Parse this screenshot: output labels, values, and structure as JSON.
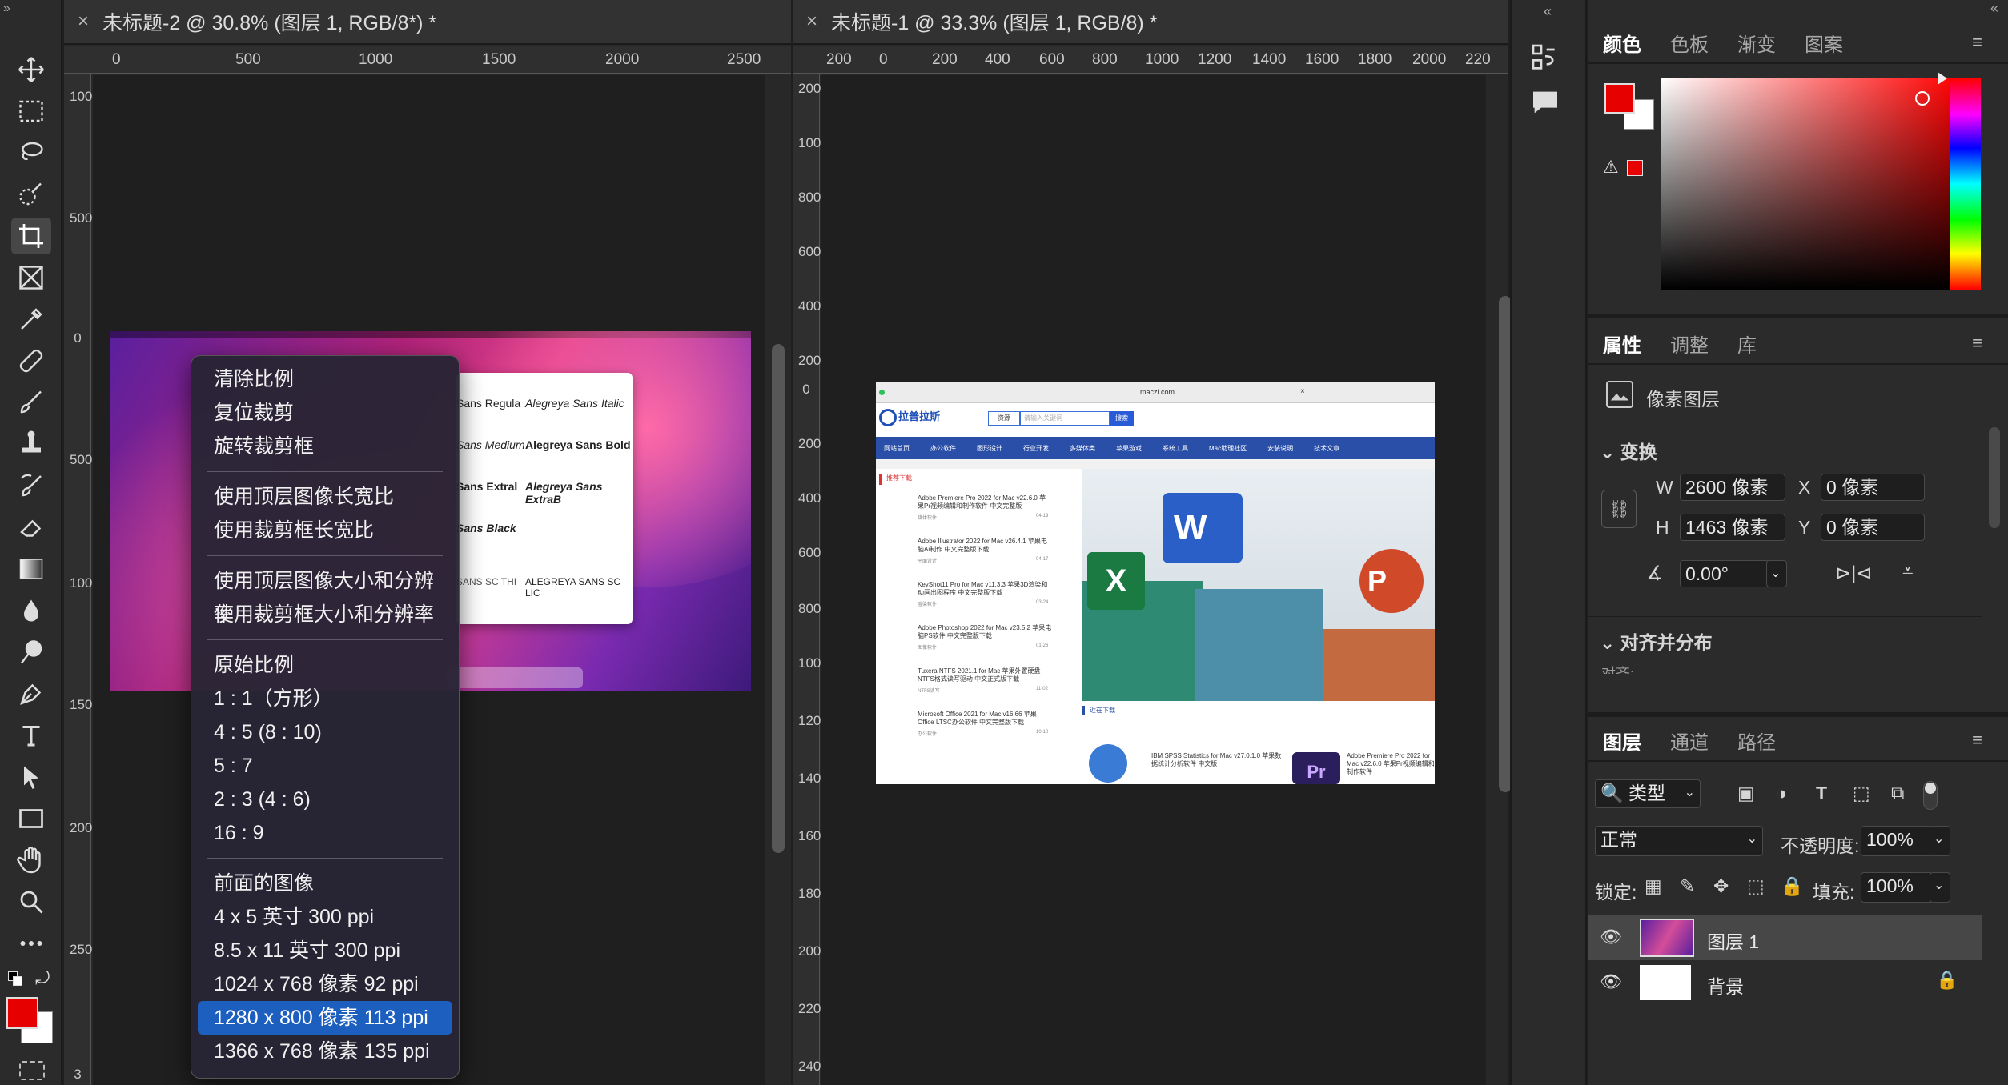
{
  "toolbar": {
    "tools": [
      "move-tool",
      "marquee-tool",
      "lasso-tool",
      "quick-select-tool",
      "crop-tool",
      "frame-tool",
      "eyedropper-tool",
      "healing-brush-tool",
      "brush-tool",
      "stamp-tool",
      "history-brush-tool",
      "eraser-tool",
      "gradient-tool",
      "blur-tool",
      "dodge-tool",
      "pen-tool",
      "type-tool",
      "path-select-tool",
      "rectangle-tool",
      "hand-tool",
      "zoom-tool",
      "more-tools"
    ],
    "foreground_color": "#e60000",
    "background_color": "#ffffff"
  },
  "doc1": {
    "tab_title": "未标题-2 @ 30.8% (图层 1, RGB/8*) *",
    "ruler_h": [
      "0",
      "500",
      "1000",
      "1500",
      "2000",
      "2500"
    ],
    "ruler_v": [
      "1000",
      "500",
      "0",
      "500",
      "1000",
      "1500",
      "2000",
      "2500",
      "3"
    ]
  },
  "doc2": {
    "tab_title": "未标题-1 @ 33.3% (图层 1, RGB/8) *",
    "ruler_h": [
      "200",
      "0",
      "200",
      "400",
      "600",
      "800",
      "1000",
      "1200",
      "1400",
      "1600",
      "1800",
      "2000",
      "220"
    ],
    "ruler_v": [
      "200",
      "100",
      "800",
      "600",
      "400",
      "200",
      "0",
      "200",
      "400",
      "600",
      "800",
      "1000",
      "1200",
      "1400",
      "1600",
      "1800",
      "2000",
      "2200",
      "2400"
    ]
  },
  "context_menu": {
    "groups": [
      [
        "清除比例",
        "复位裁剪",
        "旋转裁剪框"
      ],
      [
        "使用顶层图像长宽比",
        "使用裁剪框长宽比"
      ],
      [
        "使用顶层图像大小和分辨率",
        "使用裁剪框大小和分辨率"
      ],
      [
        "原始比例",
        "1 : 1（方形）",
        "4 : 5 (8 : 10)",
        "5 : 7",
        "2 : 3 (4 : 6)",
        "16 : 9"
      ],
      [
        "前面的图像",
        "4 x 5 英寸 300 ppi",
        "8.5 x 11 英寸 300 ppi",
        "1024 x 768 像素 92 ppi",
        "1280 x 800 像素 113 ppi",
        "1366 x 768 像素 135 ppi"
      ]
    ],
    "selected": "1280 x 800 像素 113 ppi"
  },
  "font_preview": [
    "Sans Regula",
    "Alegreya Sans Italic",
    "Sans Medium",
    "Alegreya Sans Bold",
    "Sans Extral",
    "Alegreya Sans ExtraB",
    "Sans Black",
    "SANS SC THI",
    "ALEGREYA SANS SC LIC"
  ],
  "website": {
    "url": "maczl.com",
    "logo": "拉普拉斯",
    "search_button": "搜索",
    "search_scope": "资源",
    "search_placeholder": "请输入关键词",
    "nav": [
      "网站首页",
      "办公软件",
      "图形设计",
      "行业开发",
      "多媒体类",
      "苹果游戏",
      "系统工具",
      "Mac助理社区",
      "安装说明",
      "技术文章"
    ],
    "section_recommend": "推荐下载",
    "section_recent": "近在下载",
    "articles": [
      {
        "title": "Adobe Premiere Pro 2022 for Mac v22.6.0 苹果Pr视频编辑和制作软件 中文完整版",
        "tag": "媒体软件",
        "date": "04-19"
      },
      {
        "title": "Adobe Illustrator 2022 for Mac v26.4.1 苹果电脑Ai制作 中文完整版下载",
        "tag": "平面设计",
        "date": "04-17"
      },
      {
        "title": "KeyShot11 Pro for Mac v11.3.3 苹果3D渲染和动画出图程序 中文完整版下载",
        "tag": "渲染软件",
        "date": "03-24"
      },
      {
        "title": "Adobe Photoshop 2022 for Mac v23.5.2 苹果电脑PS软件 中文完整版下载",
        "tag": "图像软件",
        "date": "01-26"
      },
      {
        "title": "Tuxera NTFS 2021.1 for Mac 苹果外置硬盘NTFS格式读写驱动 中文正式版下载",
        "tag": "NTFS读写",
        "date": "11-02"
      },
      {
        "title": "Microsoft Office 2021 for Mac v16.66 苹果Office LTSC办公软件 中文完整版下载",
        "tag": "办公软件",
        "date": "10-10"
      }
    ],
    "recent": [
      {
        "title": "IBM SPSS Statistics for Mac v27.0.1.0 苹果数据统计分析软件 中文版"
      },
      {
        "title": "Adobe Premiere Pro 2022 for Mac v22.6.0 苹果Pr视频编辑和制作软件"
      }
    ]
  },
  "color_panel": {
    "tabs": [
      "颜色",
      "色板",
      "渐变",
      "图案"
    ],
    "foreground": "#e60000",
    "background": "#ffffff"
  },
  "properties_panel": {
    "tabs": [
      "属性",
      "调整",
      "库"
    ],
    "layer_type": "像素图层",
    "transform_label": "变换",
    "w_label": "W",
    "w_value": "2600 像素",
    "h_label": "H",
    "h_value": "1463 像素",
    "x_label": "X",
    "x_value": "0 像素",
    "y_label": "Y",
    "y_value": "0 像素",
    "angle_value": "0.00°",
    "align_label": "对齐并分布",
    "align_sub": "对齐:"
  },
  "layers_panel": {
    "tabs": [
      "图层",
      "通道",
      "路径"
    ],
    "filter_label": "类型",
    "blend_mode": "正常",
    "opacity_label": "不透明度:",
    "opacity_value": "100%",
    "lock_label": "锁定:",
    "fill_label": "填充:",
    "fill_value": "100%",
    "layers": [
      {
        "name": "图层 1",
        "selected": true
      },
      {
        "name": "背景",
        "locked": true
      }
    ]
  }
}
